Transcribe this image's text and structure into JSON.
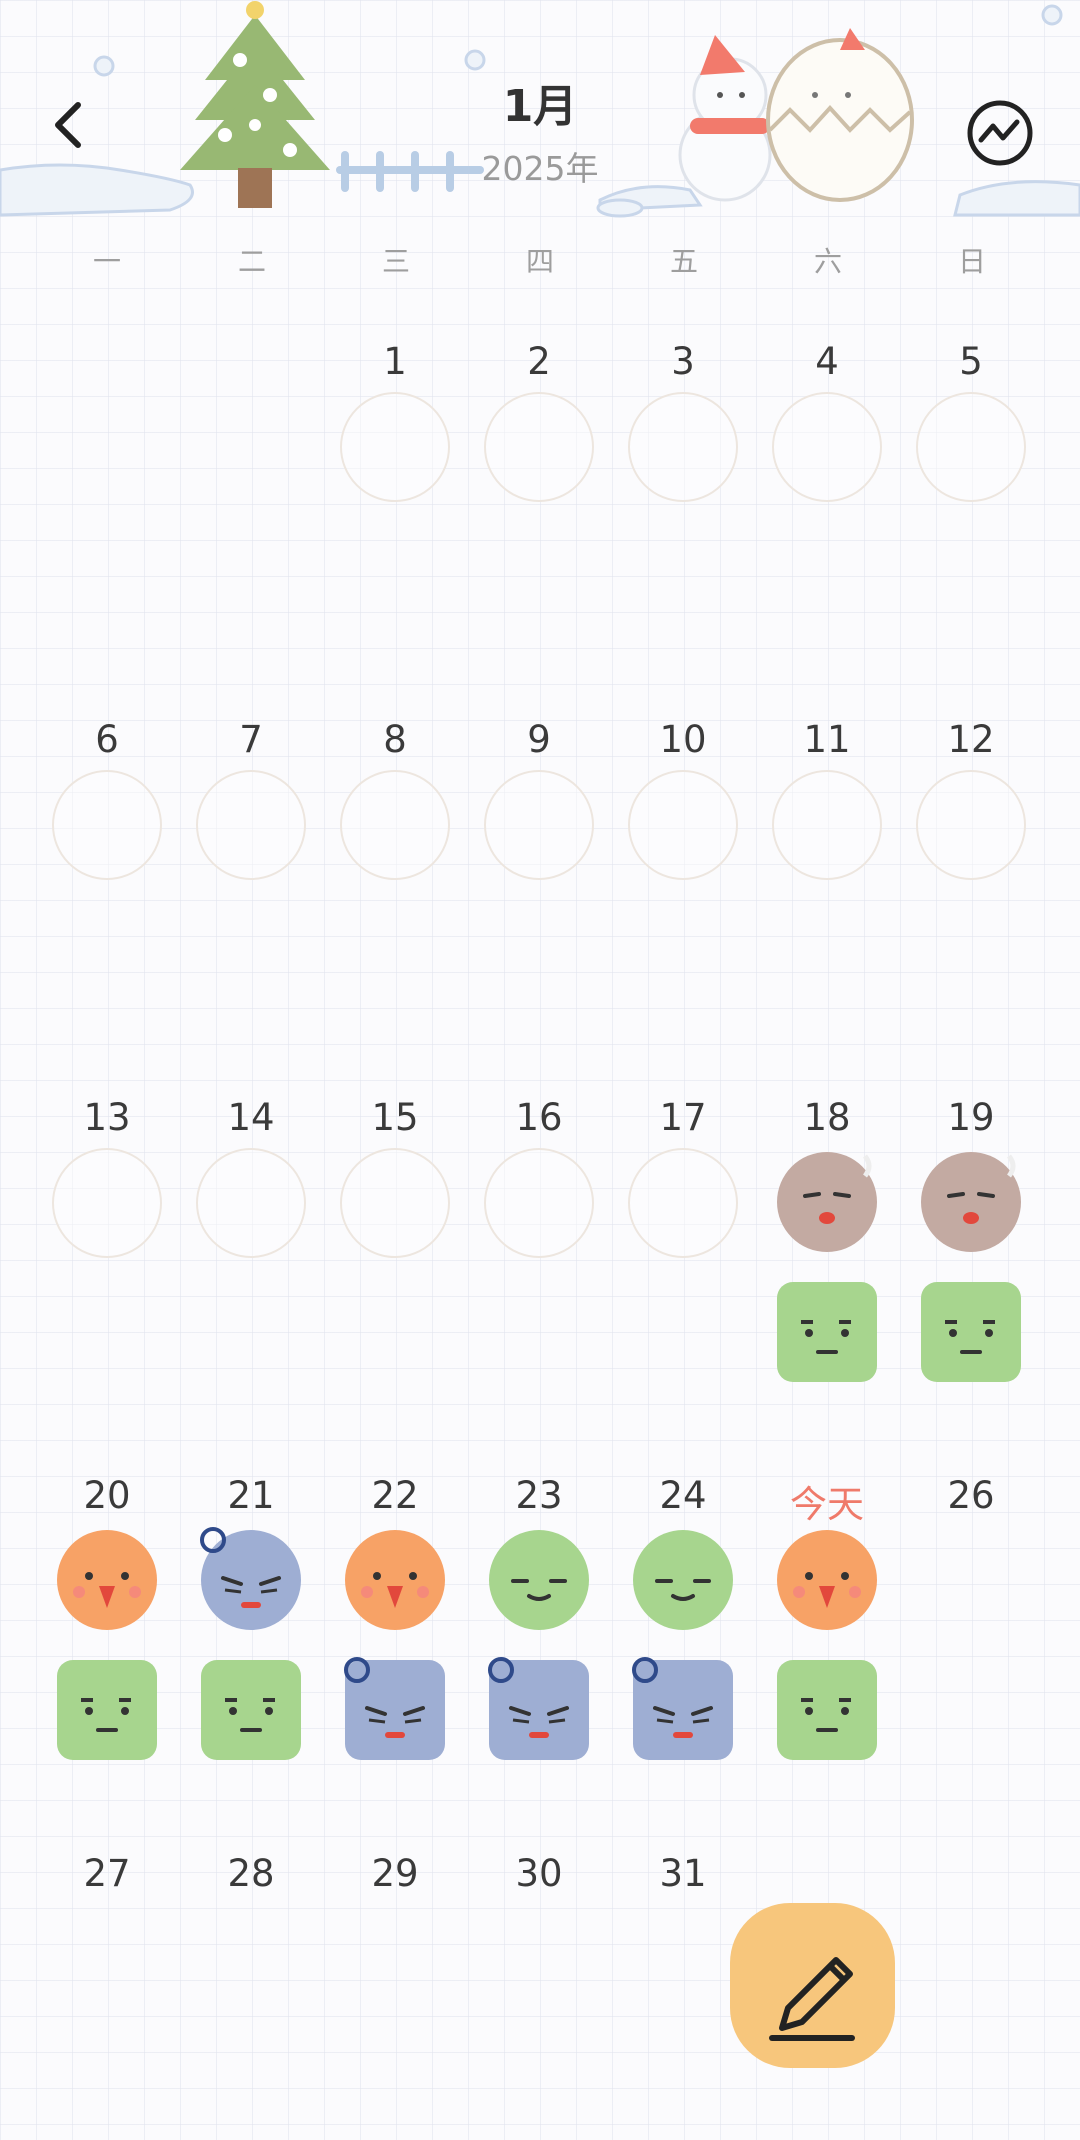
{
  "header": {
    "month": "1月",
    "year": "2025年",
    "back_icon": "chevron-left-icon",
    "stats_icon": "trend-chart-icon"
  },
  "weekdays": [
    "一",
    "二",
    "三",
    "四",
    "五",
    "六",
    "日"
  ],
  "today_label": "今天",
  "days": [
    {
      "label": "1",
      "col": 2,
      "week": 0,
      "moods": []
    },
    {
      "label": "2",
      "col": 3,
      "week": 0,
      "moods": []
    },
    {
      "label": "3",
      "col": 4,
      "week": 0,
      "moods": []
    },
    {
      "label": "4",
      "col": 5,
      "week": 0,
      "moods": []
    },
    {
      "label": "5",
      "col": 6,
      "week": 0,
      "moods": []
    },
    {
      "label": "6",
      "col": 0,
      "week": 1,
      "moods": []
    },
    {
      "label": "7",
      "col": 1,
      "week": 1,
      "moods": []
    },
    {
      "label": "8",
      "col": 2,
      "week": 1,
      "moods": []
    },
    {
      "label": "9",
      "col": 3,
      "week": 1,
      "moods": []
    },
    {
      "label": "10",
      "col": 4,
      "week": 1,
      "moods": []
    },
    {
      "label": "11",
      "col": 5,
      "week": 1,
      "moods": []
    },
    {
      "label": "12",
      "col": 6,
      "week": 1,
      "moods": []
    },
    {
      "label": "13",
      "col": 0,
      "week": 2,
      "moods": []
    },
    {
      "label": "14",
      "col": 1,
      "week": 2,
      "moods": []
    },
    {
      "label": "15",
      "col": 2,
      "week": 2,
      "moods": []
    },
    {
      "label": "16",
      "col": 3,
      "week": 2,
      "moods": []
    },
    {
      "label": "17",
      "col": 4,
      "week": 2,
      "moods": []
    },
    {
      "label": "18",
      "col": 5,
      "week": 2,
      "moods": [
        "sigh-brown-circle",
        "calm-green-square"
      ]
    },
    {
      "label": "19",
      "col": 6,
      "week": 2,
      "moods": [
        "sigh-brown-circle",
        "calm-green-square"
      ]
    },
    {
      "label": "20",
      "col": 0,
      "week": 3,
      "moods": [
        "angry-orange-circle",
        "calm-green-square"
      ]
    },
    {
      "label": "21",
      "col": 1,
      "week": 3,
      "moods": [
        "frustrated-blue-circle",
        "calm-green-square"
      ]
    },
    {
      "label": "22",
      "col": 2,
      "week": 3,
      "moods": [
        "angry-orange-circle",
        "frustrated-blue-square"
      ]
    },
    {
      "label": "23",
      "col": 3,
      "week": 3,
      "moods": [
        "content-green-circle",
        "frustrated-blue-square"
      ]
    },
    {
      "label": "24",
      "col": 4,
      "week": 3,
      "moods": [
        "content-green-circle",
        "frustrated-blue-square"
      ]
    },
    {
      "label": "今天",
      "col": 5,
      "week": 3,
      "today": true,
      "moods": [
        "angry-orange-circle",
        "calm-green-square"
      ]
    },
    {
      "label": "26",
      "col": 6,
      "week": 3,
      "moods": []
    },
    {
      "label": "27",
      "col": 0,
      "week": 4,
      "moods": []
    },
    {
      "label": "28",
      "col": 1,
      "week": 4,
      "moods": []
    },
    {
      "label": "29",
      "col": 2,
      "week": 4,
      "moods": []
    },
    {
      "label": "30",
      "col": 3,
      "week": 4,
      "moods": []
    },
    {
      "label": "31",
      "col": 4,
      "week": 4,
      "moods": []
    }
  ],
  "mood_colors": {
    "orange": "#f7a266",
    "blue": "#9eaed3",
    "green": "#a7d58e",
    "brown": "#c3aaa2",
    "accent_today": "#ef7a6a"
  },
  "fab": {
    "icon": "pencil-icon",
    "color": "#f7c67c"
  }
}
